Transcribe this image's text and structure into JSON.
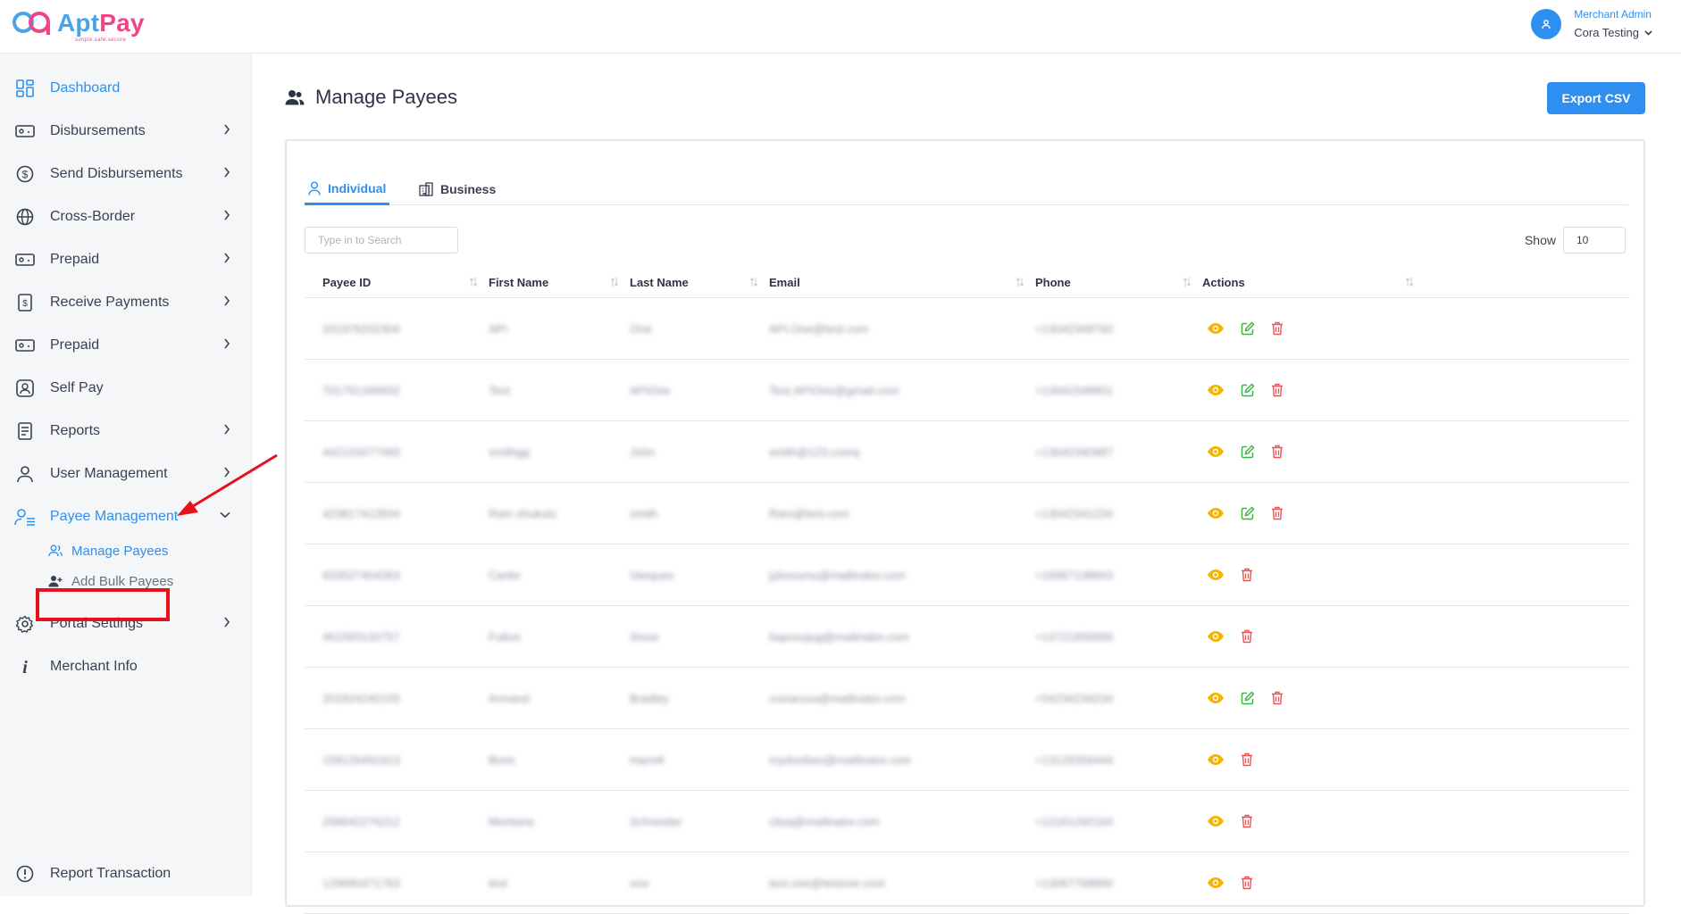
{
  "brand": {
    "name_part1": "Apt",
    "name_part2": "Pay",
    "tagline": "simple.safe.secure"
  },
  "user": {
    "role": "Merchant Admin",
    "name": "Cora Testing"
  },
  "sidebar": {
    "items": [
      {
        "label": "Dashboard",
        "icon": "dashboard-icon",
        "has_chevron": false,
        "active": true
      },
      {
        "label": "Disbursements",
        "icon": "money-icon",
        "has_chevron": true
      },
      {
        "label": "Send Disbursements",
        "icon": "dollar-circle-icon",
        "has_chevron": true
      },
      {
        "label": "Cross-Border",
        "icon": "globe-icon",
        "has_chevron": true
      },
      {
        "label": "Prepaid",
        "icon": "money-icon",
        "has_chevron": true
      },
      {
        "label": "Receive Payments",
        "icon": "invoice-icon",
        "has_chevron": true
      },
      {
        "label": "Prepaid",
        "icon": "money-icon",
        "has_chevron": true
      },
      {
        "label": "Self Pay",
        "icon": "portrait-icon",
        "has_chevron": false
      },
      {
        "label": "Reports",
        "icon": "report-icon",
        "has_chevron": true
      },
      {
        "label": "User Management",
        "icon": "user-icon",
        "has_chevron": true
      },
      {
        "label": "Payee Management",
        "icon": "user-list-icon",
        "has_chevron": true,
        "active": true,
        "expanded": true
      },
      {
        "label": "Portal Settings",
        "icon": "gear-icon",
        "has_chevron": true
      },
      {
        "label": "Merchant Info",
        "icon": "info-icon",
        "has_chevron": false
      }
    ],
    "sub_items": [
      {
        "label": "Manage Payees",
        "icon": "users-icon",
        "active": true
      },
      {
        "label": "Add Bulk Payees",
        "icon": "user-add-icon"
      }
    ],
    "footer_item": {
      "label": "Report Transaction",
      "icon": "alert-circle-icon"
    }
  },
  "page": {
    "title": "Manage Payees",
    "export_label": "Export CSV"
  },
  "tabs": [
    {
      "label": "Individual",
      "icon": "user-icon",
      "active": true
    },
    {
      "label": "Business",
      "icon": "building-icon",
      "active": false
    }
  ],
  "search": {
    "placeholder": "Type in to Search"
  },
  "show": {
    "label": "Show",
    "value": "10"
  },
  "table": {
    "columns": [
      "Payee ID",
      "First Name",
      "Last Name",
      "Email",
      "Phone",
      "Actions"
    ],
    "rows": [
      {
        "id": "331976202304",
        "first": "API",
        "last": "One",
        "email": "API.One@test.com",
        "phone": "+13042348760",
        "editable": true
      },
      {
        "id": "701791349932",
        "first": "Test",
        "last": "APIOne",
        "email": "Test.APIOne@gmail.com",
        "phone": "+13042348901",
        "editable": true
      },
      {
        "id": "442133477493",
        "first": "smithgg",
        "last": "John",
        "email": "smith@123.comq",
        "phone": "+13042340987",
        "editable": true
      },
      {
        "id": "423817412834",
        "first": "Ram shukulu",
        "last": "smith",
        "email": "Ram@test.com",
        "phone": "+13042341234",
        "editable": true
      },
      {
        "id": "833527404263",
        "first": "Carter",
        "last": "Vasquez",
        "email": "jyboxumu@mailinator.com",
        "phone": "+16967138943",
        "editable": false
      },
      {
        "id": "461593132757",
        "first": "Fulton",
        "last": "Snow",
        "email": "bapoxujug@mailinator.com",
        "phone": "+14721956669",
        "editable": false
      },
      {
        "id": "201824240155",
        "first": "Armand",
        "last": "Bradley",
        "email": "coxiaruxa@mailinator.com",
        "phone": "+54234234234",
        "editable": true
      },
      {
        "id": "158126491613",
        "first": "Boris",
        "last": "Harrell",
        "email": "mydusibes@mailinator.com",
        "phone": "+13129356444",
        "editable": false
      },
      {
        "id": "258642276212",
        "first": "Montana",
        "last": "Schneider",
        "email": "cityq@mailinator.com",
        "phone": "+12161292164",
        "editable": false
      },
      {
        "id": "129690471763",
        "first": "test",
        "last": "one",
        "email": "test.one@testone.com",
        "phone": "+13067768890",
        "editable": false
      }
    ]
  },
  "colors": {
    "accent": "#2f8ff0",
    "view": "#f5b400",
    "edit": "#3cb34a",
    "delete": "#ef5350",
    "highlight": "#e8101c"
  }
}
